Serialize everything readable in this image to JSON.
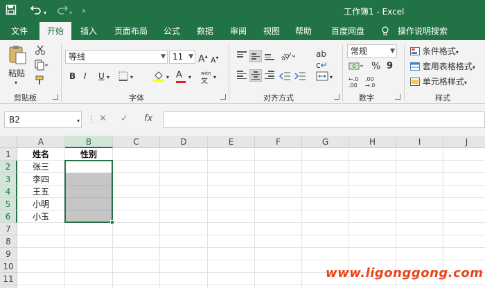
{
  "window": {
    "title": "工作簿1  -  Excel",
    "accent": "#217346"
  },
  "quick_access": {
    "save_icon": "save-icon",
    "undo_icon": "undo-icon",
    "redo_icon": "redo-icon",
    "customize_icon": "customize-icon"
  },
  "tabs": [
    {
      "label": "文件"
    },
    {
      "label": "开始",
      "active": true
    },
    {
      "label": "插入"
    },
    {
      "label": "页面布局"
    },
    {
      "label": "公式"
    },
    {
      "label": "数据"
    },
    {
      "label": "审阅"
    },
    {
      "label": "视图"
    },
    {
      "label": "帮助"
    },
    {
      "label": "百度网盘"
    },
    {
      "label": "操作说明搜索"
    }
  ],
  "ribbon": {
    "clipboard": {
      "paste_label": "粘贴",
      "group_label": "剪贴板"
    },
    "font": {
      "font_name": "等线",
      "font_size": "11",
      "grow_label": "A",
      "shrink_label": "A",
      "bold": "B",
      "italic": "I",
      "underline": "U",
      "font_color": "A",
      "group_label": "字体",
      "wen": "wén",
      "wen_char": "文"
    },
    "alignment": {
      "group_label": "对齐方式",
      "wrap": "ab",
      "wrap2": "c"
    },
    "number": {
      "format": "常规",
      "percent": "%",
      "comma": "9",
      "group_label": "数字"
    },
    "styles": {
      "conditional": "条件格式",
      "table": "套用表格格式",
      "cell_styles": "单元格样式",
      "group_label": "样式"
    }
  },
  "formula_bar": {
    "name_box": "B2",
    "cancel": "✕",
    "enter": "✓",
    "fx": "fx",
    "value": ""
  },
  "grid": {
    "columns": [
      "A",
      "B",
      "C",
      "D",
      "E",
      "F",
      "G",
      "H",
      "I",
      "J"
    ],
    "rows": [
      "1",
      "2",
      "3",
      "4",
      "5",
      "6",
      "7",
      "8",
      "9",
      "10",
      "11",
      "12"
    ],
    "cells": {
      "A1": "姓名",
      "B1": "性别",
      "A2": "张三",
      "A3": "李四",
      "A4": "王五",
      "A5": "小明",
      "A6": "小玉"
    },
    "active_cell": "B2",
    "selection": "B2:B6"
  },
  "watermark": "www.ligonggong.com"
}
